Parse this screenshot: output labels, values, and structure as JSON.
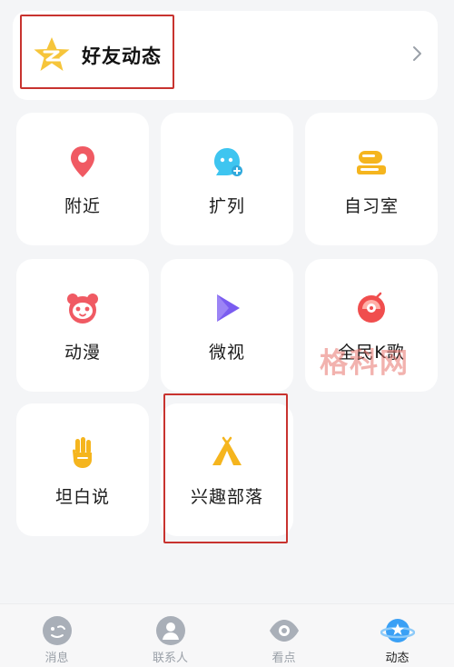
{
  "feed": {
    "title": "好友动态",
    "star_icon": "qzone-star-icon",
    "chevron_icon": "chevron-right-icon"
  },
  "tiles": [
    {
      "label": "附近",
      "icon": "location-pin-icon",
      "color": "#f05a63"
    },
    {
      "label": "扩列",
      "icon": "smile-add-icon",
      "color": "#3ec5f0"
    },
    {
      "label": "自习室",
      "icon": "study-lamp-icon",
      "color": "#f5b51e"
    },
    {
      "label": "动漫",
      "icon": "panda-face-icon",
      "color": "#f05a63"
    },
    {
      "label": "微视",
      "icon": "play-video-icon",
      "color": "#7a5cf0"
    },
    {
      "label": "全民K歌",
      "icon": "karaoke-icon",
      "color": "#f04e4e"
    },
    {
      "label": "坦白说",
      "icon": "hand-icon",
      "color": "#f5b51e"
    },
    {
      "label": "兴趣部落",
      "icon": "tent-icon",
      "color": "#f5b51e"
    }
  ],
  "watermark": "格科网",
  "tabs": [
    {
      "label": "消息",
      "icon": "message-icon",
      "active": false
    },
    {
      "label": "联系人",
      "icon": "contacts-icon",
      "active": false
    },
    {
      "label": "看点",
      "icon": "eye-icon",
      "active": false
    },
    {
      "label": "动态",
      "icon": "planet-icon",
      "active": true
    }
  ],
  "colors": {
    "highlight": "#c8332f",
    "background": "#f4f5f7",
    "card": "#ffffff",
    "active_tab": "#3aa0f5"
  }
}
